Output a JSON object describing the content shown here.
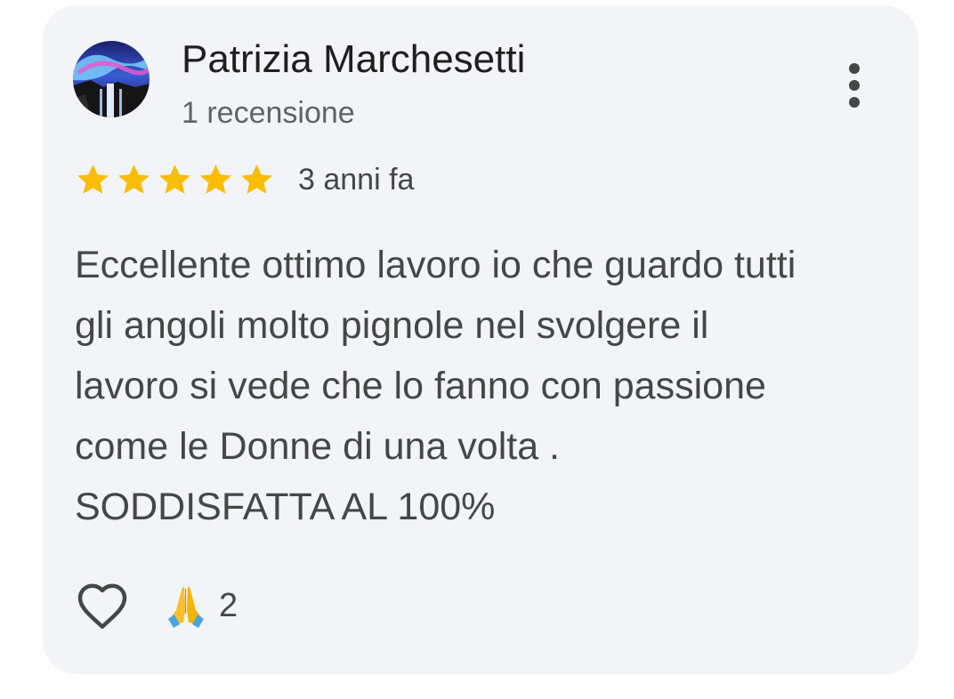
{
  "review": {
    "author_name": "Patrizia Marchesetti",
    "author_meta": "1 recensione",
    "rating": 5,
    "rating_max": 5,
    "date": "3 anni fa",
    "text": "Eccellente ottimo lavoro io che guardo tutti\ngli angoli molto pignole nel svolgere il\nlavoro si vede che lo fanno con passione\ncome le Donne di una volta .\nSODDISFATTA AL 100%",
    "reaction_count": "2"
  },
  "icons": {
    "avatar": "avatar-image",
    "more": "more-vert-icon",
    "star": "star-icon",
    "like": "heart-outline-icon",
    "reaction": "folded-hands-emoji"
  },
  "colors": {
    "card_background": "#f3f4f8",
    "star": "#fbbc04",
    "text_primary": "#1f1f1f",
    "text_secondary": "#444746"
  }
}
